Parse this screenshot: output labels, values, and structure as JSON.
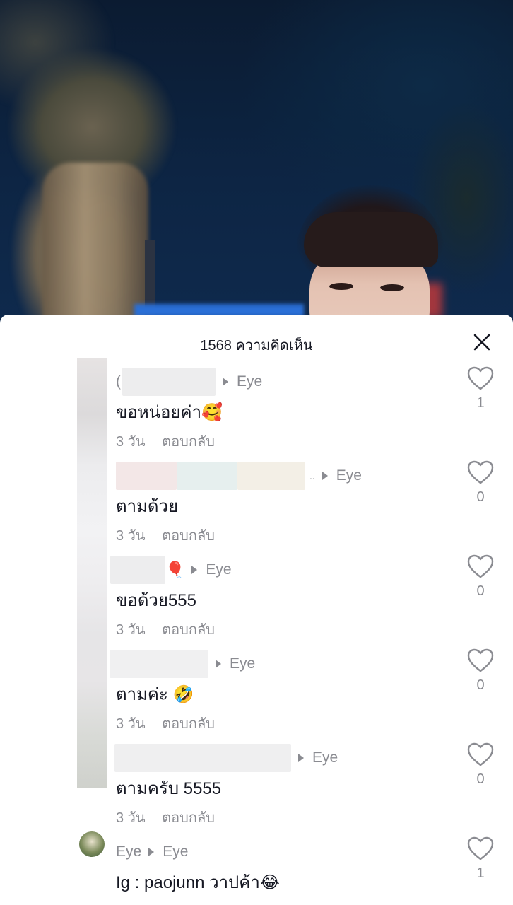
{
  "sheet": {
    "title": "1568 ความคิดเห็น",
    "close_icon": "close-icon"
  },
  "colors": {
    "text_primary": "#161823",
    "text_secondary": "#8a8b91",
    "sheet_bg": "#ffffff"
  },
  "comments": [
    {
      "author_visible": "(",
      "reply_to": "Eye",
      "text": "ขอหน่อยค่า🥰",
      "time": "3 วัน",
      "reply_label": "ตอบกลับ",
      "likes": "1"
    },
    {
      "author_visible": "",
      "reply_to": "Eye",
      "text": "ตามด้วย",
      "time": "3 วัน",
      "reply_label": "ตอบกลับ",
      "likes": "0"
    },
    {
      "author_visible": "🎈",
      "reply_to": "Eye",
      "text": "ขอด้วย555",
      "time": "3 วัน",
      "reply_label": "ตอบกลับ",
      "likes": "0"
    },
    {
      "author_visible": "",
      "reply_to": "Eye",
      "text": "ตามค่ะ 🤣",
      "time": "3 วัน",
      "reply_label": "ตอบกลับ",
      "likes": "0"
    },
    {
      "author_visible": "",
      "reply_to": "Eye",
      "text": "ตามครับ 5555",
      "time": "3 วัน",
      "reply_label": "ตอบกลับ",
      "likes": "0"
    },
    {
      "author_visible": "Eye",
      "reply_to": "Eye",
      "text": "Ig : paojunn วาปค้า😂",
      "time": "",
      "reply_label": "",
      "likes": "1"
    }
  ]
}
